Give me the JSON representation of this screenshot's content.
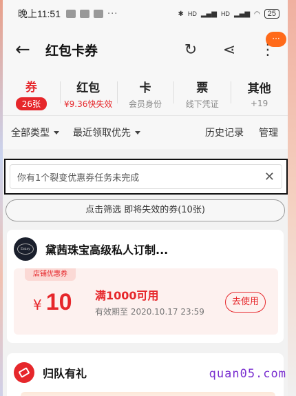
{
  "status_bar": {
    "time": "晚上11:51",
    "dots": "···",
    "network_1": "HD",
    "network_2": "HD",
    "battery": "25"
  },
  "header": {
    "title": "红包卡券",
    "back_glyph": "←",
    "refresh_glyph": "↻",
    "share_glyph": "⋖",
    "more_glyph": "⋮",
    "badge_text": "···"
  },
  "categories": [
    {
      "name": "券",
      "sub": "26张"
    },
    {
      "name": "红包",
      "sub": "¥9.36快失效"
    },
    {
      "name": "卡",
      "sub": "会员身份"
    },
    {
      "name": "票",
      "sub": "线下凭证"
    },
    {
      "name": "其他",
      "sub": "+19"
    }
  ],
  "filters": {
    "type": "全部类型",
    "sort": "最近领取优先",
    "history": "历史记录",
    "manage": "管理"
  },
  "notice": {
    "text": "你有1个裂变优惠券任务未完成",
    "close_glyph": "✕"
  },
  "screen_button": "点击筛选 即将失效的券(10张)",
  "coupons": [
    {
      "shop": "黛茜珠宝高级私人订制...",
      "logo_text": "Daisy",
      "tag": "店铺优惠券",
      "currency": "¥",
      "amount": "10",
      "condition": "满1000可用",
      "expiry": "有效期至 2020.10.17 23:59",
      "use_label": "去使用"
    }
  ],
  "card2": {
    "title": "归队有礼"
  },
  "watermark": "quan05.com",
  "colors": {
    "accent": "#e6272b",
    "badge": "#ff6a1a"
  }
}
